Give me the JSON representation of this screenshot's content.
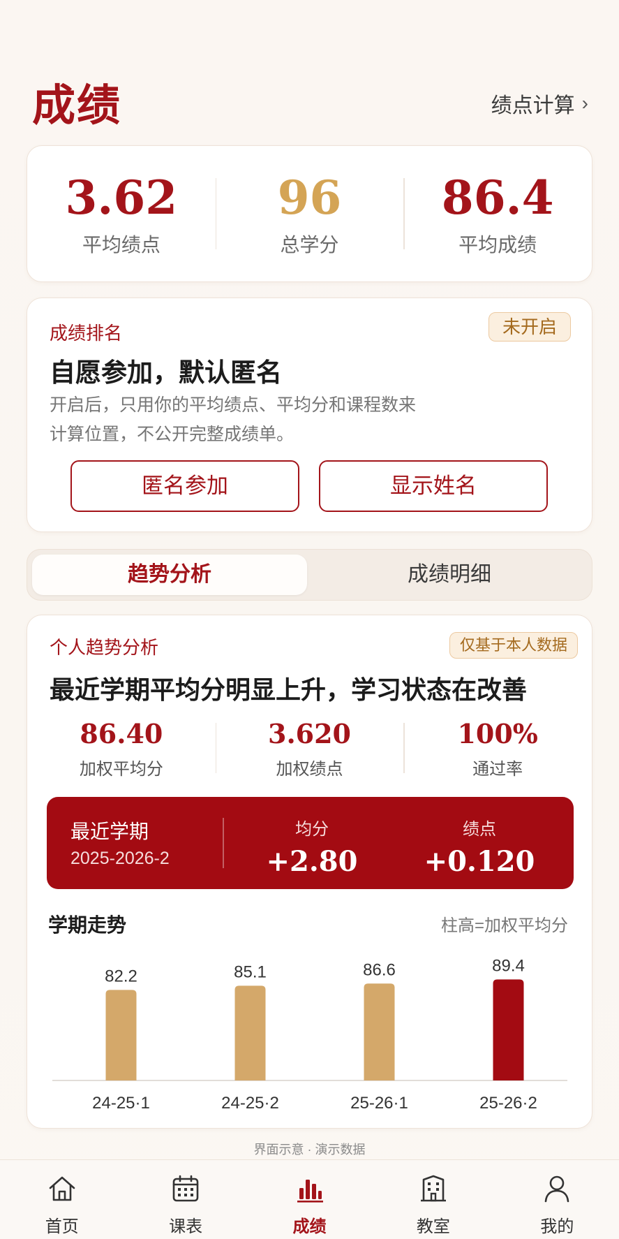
{
  "header": {
    "title": "成绩",
    "gpa_link": "绩点计算",
    "gpa_link_chevron": "›"
  },
  "summary": [
    {
      "value": "3.62",
      "label": "平均绩点",
      "color": "#a3141a"
    },
    {
      "value": "96",
      "label": "总学分",
      "color": "#d4a455"
    },
    {
      "value": "86.4",
      "label": "平均成绩",
      "color": "#a3141a"
    }
  ],
  "ranking": {
    "kicker": "成绩排名",
    "badge": "未开启",
    "headline": "自愿参加，默认匿名",
    "desc_line1": "开启后，只用你的平均绩点、平均分和课程数来",
    "desc_line2": "计算位置，不公开完整成绩单。",
    "anonymous_button": "匿名参加",
    "show_name_button": "显示姓名"
  },
  "tabs": {
    "active": "趋势分析",
    "inactive": "成绩明细"
  },
  "trend": {
    "kicker": "个人趋势分析",
    "badge": "仅基于本人数据",
    "headline": "最近学期平均分明显上升，学习状态在改善",
    "metrics": [
      {
        "value": "86.40",
        "label": "加权平均分"
      },
      {
        "value": "3.620",
        "label": "加权绩点"
      },
      {
        "value": "100%",
        "label": "通过率"
      }
    ],
    "delta": {
      "title": "最近学期",
      "term": "2025-2026-2",
      "score_label": "均分",
      "score_value": "+2.80",
      "gpa_label": "绩点",
      "gpa_value": "+0.120"
    },
    "chart_title": "学期走势",
    "chart_note": "柱高=加权平均分"
  },
  "chart_data": {
    "type": "bar",
    "categories": [
      "24-25·1",
      "24-25·2",
      "25-26·1",
      "25-26·2"
    ],
    "values": [
      82.2,
      85.1,
      86.6,
      89.4
    ],
    "bar_colors": [
      "#d4a86a",
      "#d4a86a",
      "#d4a86a",
      "#a30b12"
    ],
    "title": "学期走势",
    "xlabel": "",
    "ylabel": "",
    "ylim": [
      20,
      92
    ]
  },
  "footnote": "界面示意 · 演示数据",
  "nav": [
    {
      "label": "首页",
      "icon": "home-icon"
    },
    {
      "label": "课表",
      "icon": "calendar-icon"
    },
    {
      "label": "成绩",
      "icon": "bar-chart-icon",
      "active": true
    },
    {
      "label": "教室",
      "icon": "building-icon"
    },
    {
      "label": "我的",
      "icon": "user-icon"
    }
  ],
  "colors": {
    "accent": "#a3141a",
    "gold": "#d4a455",
    "bar_gold": "#d4a86a",
    "deep_red": "#a30b12"
  }
}
